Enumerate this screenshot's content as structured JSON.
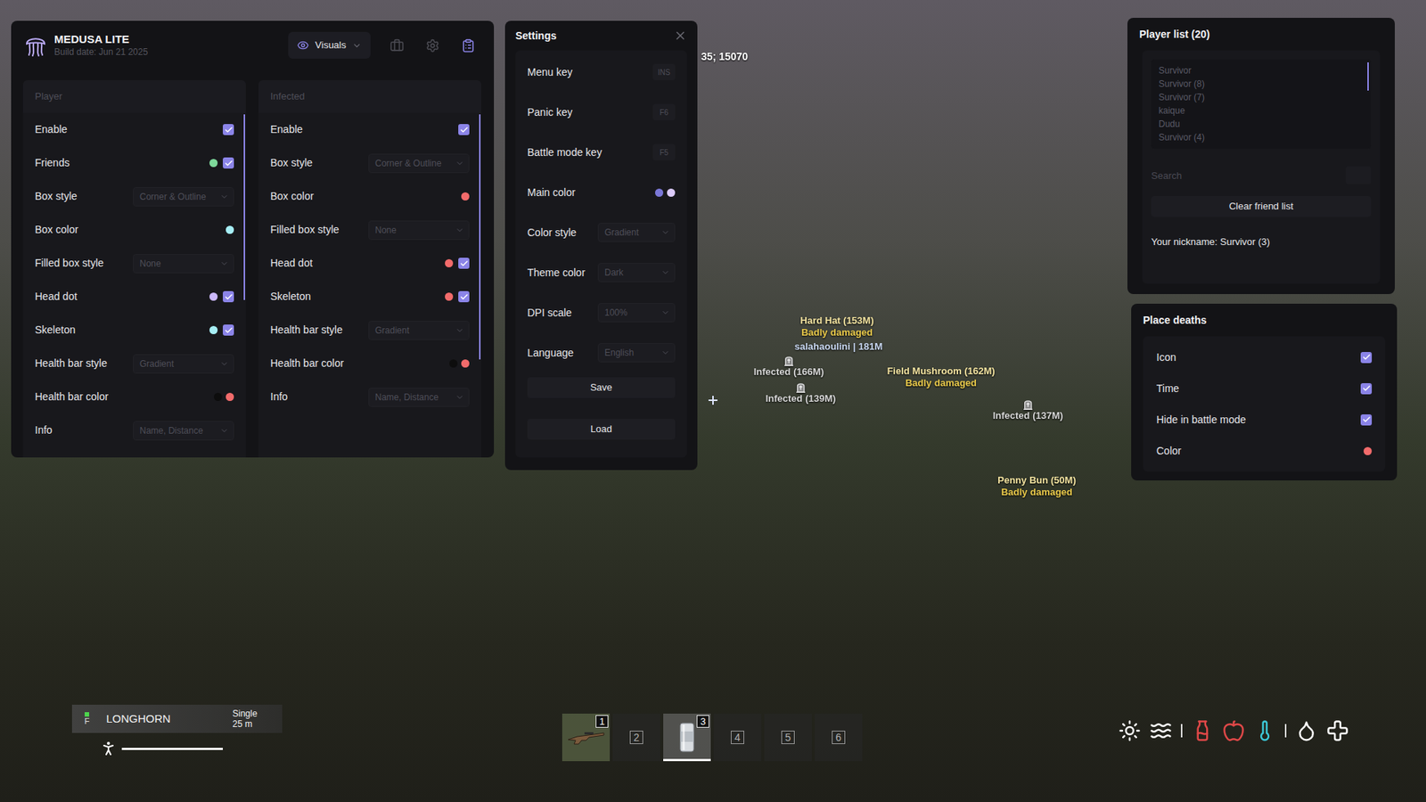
{
  "main_window": {
    "title": "MEDUSA LITE",
    "subtitle": "Build date: Jun 21 2025",
    "tab": {
      "label": "Visuals",
      "selected": true
    },
    "header_icons": [
      {
        "selected": false
      },
      {
        "selected": false
      },
      {
        "selected": true
      }
    ]
  },
  "panels": [
    {
      "title": "Player",
      "rows": [
        {
          "label": "Enable",
          "kind": "check",
          "checked": true
        },
        {
          "label": "Friends",
          "kind": "color-check",
          "colors": [
            "#7ed99b"
          ],
          "checked": true
        },
        {
          "label": "Box style",
          "kind": "select",
          "value": "Corner & Outline"
        },
        {
          "label": "Box color",
          "kind": "color",
          "colors": [
            "#a6eef5"
          ]
        },
        {
          "label": "Filled box style",
          "kind": "select",
          "value": "None"
        },
        {
          "label": "Head dot",
          "kind": "color-check",
          "colors": [
            "#cbb8fb"
          ],
          "checked": true
        },
        {
          "label": "Skeleton",
          "kind": "color-check",
          "colors": [
            "#a6eef5"
          ],
          "checked": true
        },
        {
          "label": "Health bar style",
          "kind": "select",
          "value": "Gradient"
        },
        {
          "label": "Health bar color",
          "kind": "color",
          "colors": [
            "#0d0d0d",
            "#f26b6b"
          ]
        },
        {
          "label": "Info",
          "kind": "select",
          "value": "Name, Distance"
        }
      ]
    },
    {
      "title": "Infected",
      "rows": [
        {
          "label": "Enable",
          "kind": "check",
          "checked": true
        },
        {
          "label": "Box style",
          "kind": "select",
          "value": "Corner & Outline"
        },
        {
          "label": "Box color",
          "kind": "color",
          "colors": [
            "#f26b6b"
          ]
        },
        {
          "label": "Filled box style",
          "kind": "select",
          "value": "None"
        },
        {
          "label": "Head dot",
          "kind": "color-check",
          "colors": [
            "#f26b6b"
          ],
          "checked": true
        },
        {
          "label": "Skeleton",
          "kind": "color-check",
          "colors": [
            "#f26b6b"
          ],
          "checked": true
        },
        {
          "label": "Health bar style",
          "kind": "select",
          "value": "Gradient"
        },
        {
          "label": "Health bar color",
          "kind": "color",
          "colors": [
            "#0d0d0d",
            "#f26b6b"
          ]
        },
        {
          "label": "Info",
          "kind": "select",
          "value": "Name, Distance"
        }
      ]
    }
  ],
  "settings": {
    "title": "Settings",
    "rows": [
      {
        "label": "Menu key",
        "kind": "key",
        "value": "INS"
      },
      {
        "label": "Panic key",
        "kind": "key",
        "value": "F6"
      },
      {
        "label": "Battle mode key",
        "kind": "key",
        "value": "F5"
      },
      {
        "label": "Main color",
        "kind": "color",
        "colors": [
          "#7b78d8",
          "#dccbfb"
        ]
      },
      {
        "label": "Color style",
        "kind": "select",
        "value": "Gradient"
      },
      {
        "label": "Theme color",
        "kind": "select",
        "value": "Dark"
      },
      {
        "label": "DPI scale",
        "kind": "select",
        "value": "100%"
      },
      {
        "label": "Language",
        "kind": "select",
        "value": "English"
      }
    ],
    "buttons": [
      "Save",
      "Load"
    ]
  },
  "player_list": {
    "title": "Player list (20)",
    "players": [
      "Survivor",
      "Survivor (8)",
      "Survivor (7)",
      "kaique",
      "Dudu",
      "Survivor (4)"
    ],
    "search": {
      "placeholder": "Search"
    },
    "button": "Clear friend list",
    "nickname": "Your nickname: Survivor (3)"
  },
  "place_deaths": {
    "title": "Place deaths",
    "rows": [
      {
        "label": "Icon",
        "kind": "check",
        "checked": true
      },
      {
        "label": "Time",
        "kind": "check",
        "checked": true
      },
      {
        "label": "Hide in battle mode",
        "kind": "check",
        "checked": true
      },
      {
        "label": "Color",
        "kind": "color",
        "colors": [
          "#f26b6b"
        ]
      }
    ]
  },
  "coordinates": "35; 15070",
  "esp_labels": [
    {
      "kind": "item",
      "label": "Hard Hat (153M)",
      "sub": "Badly damaged",
      "color": "#f3e3a0",
      "sub_color": "#e9c94a"
    },
    {
      "kind": "player",
      "label": "salahaoulini | 181M",
      "color": "#c9d8f2"
    },
    {
      "kind": "infected",
      "label": "Infected (166M)",
      "color": "#d6d6d6"
    },
    {
      "kind": "infected",
      "label": "Infected (139M)",
      "color": "#d6d6d6"
    },
    {
      "kind": "item",
      "label": "Field Mushroom (162M)",
      "sub": "Badly damaged",
      "color": "#f3e3a0",
      "sub_color": "#e9c94a"
    },
    {
      "kind": "infected",
      "label": "Infected (137M)",
      "color": "#d6d6d6"
    },
    {
      "kind": "item",
      "label": "Penny Bun (50M)",
      "sub": "Badly damaged",
      "color": "#f3e3a0",
      "sub_color": "#e9c94a"
    }
  ],
  "hud": {
    "weapon": {
      "name": "LONGHORN",
      "key": "F",
      "mode": "Single",
      "range": "25 m",
      "ready": true
    },
    "stamina": {
      "level": 1
    },
    "hotbar": [
      {
        "label": "1",
        "kind": "rifle",
        "selected": false
      },
      {
        "label": "2",
        "kind": "empty",
        "selected": false
      },
      {
        "label": "3",
        "kind": "can",
        "selected": true
      },
      {
        "label": "4",
        "kind": "empty",
        "selected": false
      },
      {
        "label": "5",
        "kind": "empty",
        "selected": false
      },
      {
        "label": "6",
        "kind": "empty",
        "selected": false
      }
    ],
    "status_icons": [
      {
        "color": "#ffffff"
      },
      {
        "color": "#ffffff"
      },
      {
        "color": "#e04848"
      },
      {
        "color": "#e04848"
      },
      {
        "color": "#3cc8d8"
      },
      {
        "color": "#ffffff"
      },
      {
        "color": "#ffffff"
      }
    ]
  }
}
